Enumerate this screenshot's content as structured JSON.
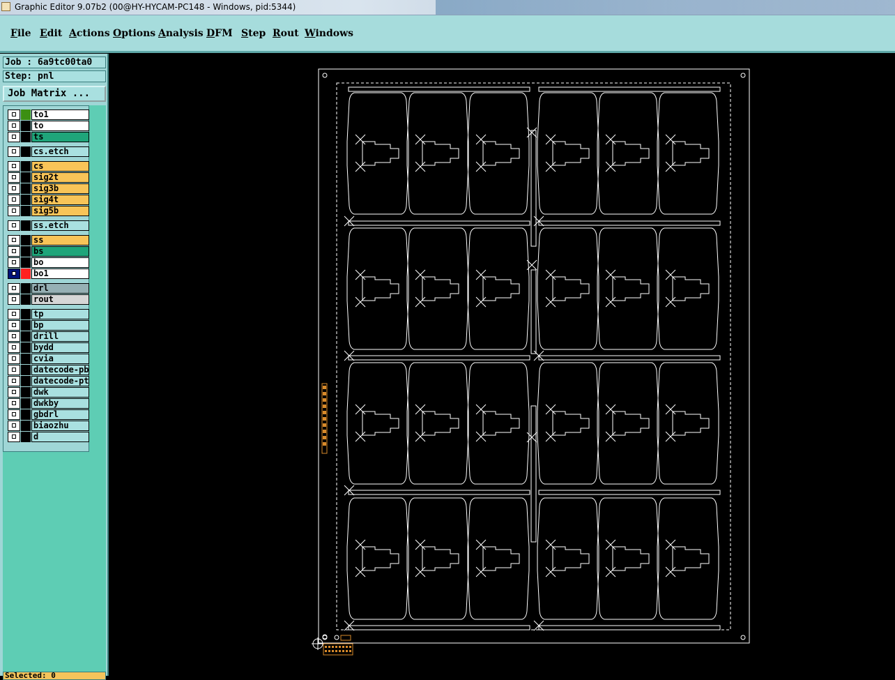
{
  "window": {
    "title": "Graphic Editor 9.07b2 (00@HY-HYCAM-PC148 - Windows, pid:5344)"
  },
  "menu": [
    {
      "label": "File"
    },
    {
      "label": "Edit"
    },
    {
      "label": "Actions"
    },
    {
      "label": "Options"
    },
    {
      "label": "Analysis"
    },
    {
      "label": "DFM"
    },
    {
      "label": "Step"
    },
    {
      "label": "Rout"
    },
    {
      "label": "Windows"
    }
  ],
  "panel": {
    "job": "Job : 6a9tc00ta0",
    "step": "Step: pnl",
    "job_matrix": "Job Matrix ...",
    "bottom_tab": "Selected: 0"
  },
  "layers": [
    {
      "name": "to1",
      "color": "white",
      "swatch": "#3c8f12",
      "selected": false,
      "group": 0
    },
    {
      "name": "to",
      "color": "white",
      "swatch": "#000000",
      "selected": false,
      "group": 0
    },
    {
      "name": "ts",
      "color": "green",
      "swatch": "#000000",
      "selected": false,
      "group": 0
    },
    {
      "name": "cs.etch",
      "color": "teal",
      "swatch": "#000000",
      "selected": false,
      "group": 1
    },
    {
      "name": "cs",
      "color": "orange",
      "swatch": "#000000",
      "selected": false,
      "group": 2
    },
    {
      "name": "sig2t",
      "color": "orange",
      "swatch": "#000000",
      "selected": false,
      "group": 2
    },
    {
      "name": "sig3b",
      "color": "orange",
      "swatch": "#000000",
      "selected": false,
      "group": 2
    },
    {
      "name": "sig4t",
      "color": "orange",
      "swatch": "#000000",
      "selected": false,
      "group": 2
    },
    {
      "name": "sig5b",
      "color": "orange",
      "swatch": "#000000",
      "selected": false,
      "group": 2
    },
    {
      "name": "ss.etch",
      "color": "teal",
      "swatch": "#000000",
      "selected": false,
      "group": 3
    },
    {
      "name": "ss",
      "color": "orange",
      "swatch": "#000000",
      "selected": false,
      "group": 4
    },
    {
      "name": "bs",
      "color": "green",
      "swatch": "#000000",
      "selected": false,
      "group": 4
    },
    {
      "name": "bo",
      "color": "white",
      "swatch": "#000000",
      "selected": false,
      "group": 4
    },
    {
      "name": "bo1",
      "color": "white",
      "swatch": "#ff2020",
      "selected": true,
      "group": 4
    },
    {
      "name": "drl",
      "color": "gray",
      "swatch": "#000000",
      "selected": false,
      "group": 5
    },
    {
      "name": "rout",
      "color": "lgray",
      "swatch": "#000000",
      "selected": false,
      "group": 5
    },
    {
      "name": "tp",
      "color": "teal",
      "swatch": "#000000",
      "selected": false,
      "group": 6
    },
    {
      "name": "bp",
      "color": "teal",
      "swatch": "#000000",
      "selected": false,
      "group": 6
    },
    {
      "name": "drill",
      "color": "teal",
      "swatch": "#000000",
      "selected": false,
      "group": 6
    },
    {
      "name": "bydd",
      "color": "teal",
      "swatch": "#000000",
      "selected": false,
      "group": 6
    },
    {
      "name": "cvia",
      "color": "teal",
      "swatch": "#000000",
      "selected": false,
      "group": 6
    },
    {
      "name": "datecode-pbc",
      "color": "teal",
      "swatch": "#000000",
      "selected": false,
      "group": 6
    },
    {
      "name": "datecode-ptc",
      "color": "teal",
      "swatch": "#000000",
      "selected": false,
      "group": 6
    },
    {
      "name": "dwk",
      "color": "teal",
      "swatch": "#000000",
      "selected": false,
      "group": 6
    },
    {
      "name": "dwkby",
      "color": "teal",
      "swatch": "#000000",
      "selected": false,
      "group": 6
    },
    {
      "name": "gbdrl",
      "color": "teal",
      "swatch": "#000000",
      "selected": false,
      "group": 6
    },
    {
      "name": "biaozhu",
      "color": "teal",
      "swatch": "#000000",
      "selected": false,
      "group": 6
    },
    {
      "name": "d",
      "color": "teal",
      "swatch": "#000000",
      "selected": false,
      "group": 6
    }
  ],
  "board": {
    "unit_rows": 4,
    "unit_cols": 6,
    "line_color": "#ffffff",
    "marker_color": "#d88a2a"
  }
}
